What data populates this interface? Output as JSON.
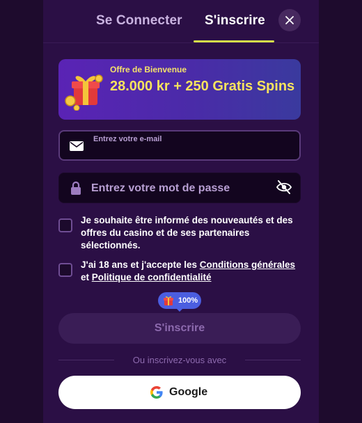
{
  "tabs": {
    "login": "Se Connecter",
    "register": "S'inscrire",
    "active": "register"
  },
  "promo": {
    "kicker": "Offre de Bienvenue",
    "title": "28.000 kr + 250 Gratis Spins"
  },
  "form": {
    "email_label": "Entrez votre e-mail",
    "email_value": "",
    "password_placeholder": "Entrez votre mot de passe",
    "password_value": ""
  },
  "consents": {
    "newsletter": {
      "text": "Je souhaite être informé des nouveautés et des offres du casino et de ses partenaires sélectionnés.",
      "checked": false
    },
    "terms": {
      "prefix": "J'ai 18 ans et j'accepte les ",
      "terms_link": "Conditions générales",
      "joiner": " et ",
      "privacy_link": "Politique de confidentialité",
      "checked": false
    }
  },
  "progress_badge": {
    "text": "100%"
  },
  "submit": {
    "label": "S'inscrire",
    "enabled": false
  },
  "alt_signup": {
    "divider": "Ou inscrivez-vous avec",
    "google_label": "Google"
  },
  "colors": {
    "accent_underline": "#d6e04a",
    "promo_text": "#f7e35e",
    "badge": "#4b5ee0"
  },
  "icons": {
    "close": "close-icon",
    "email": "envelope-icon",
    "password": "lock-icon",
    "visibility": "eye-off-icon",
    "promo": "gift-icon",
    "google": "google-icon"
  }
}
